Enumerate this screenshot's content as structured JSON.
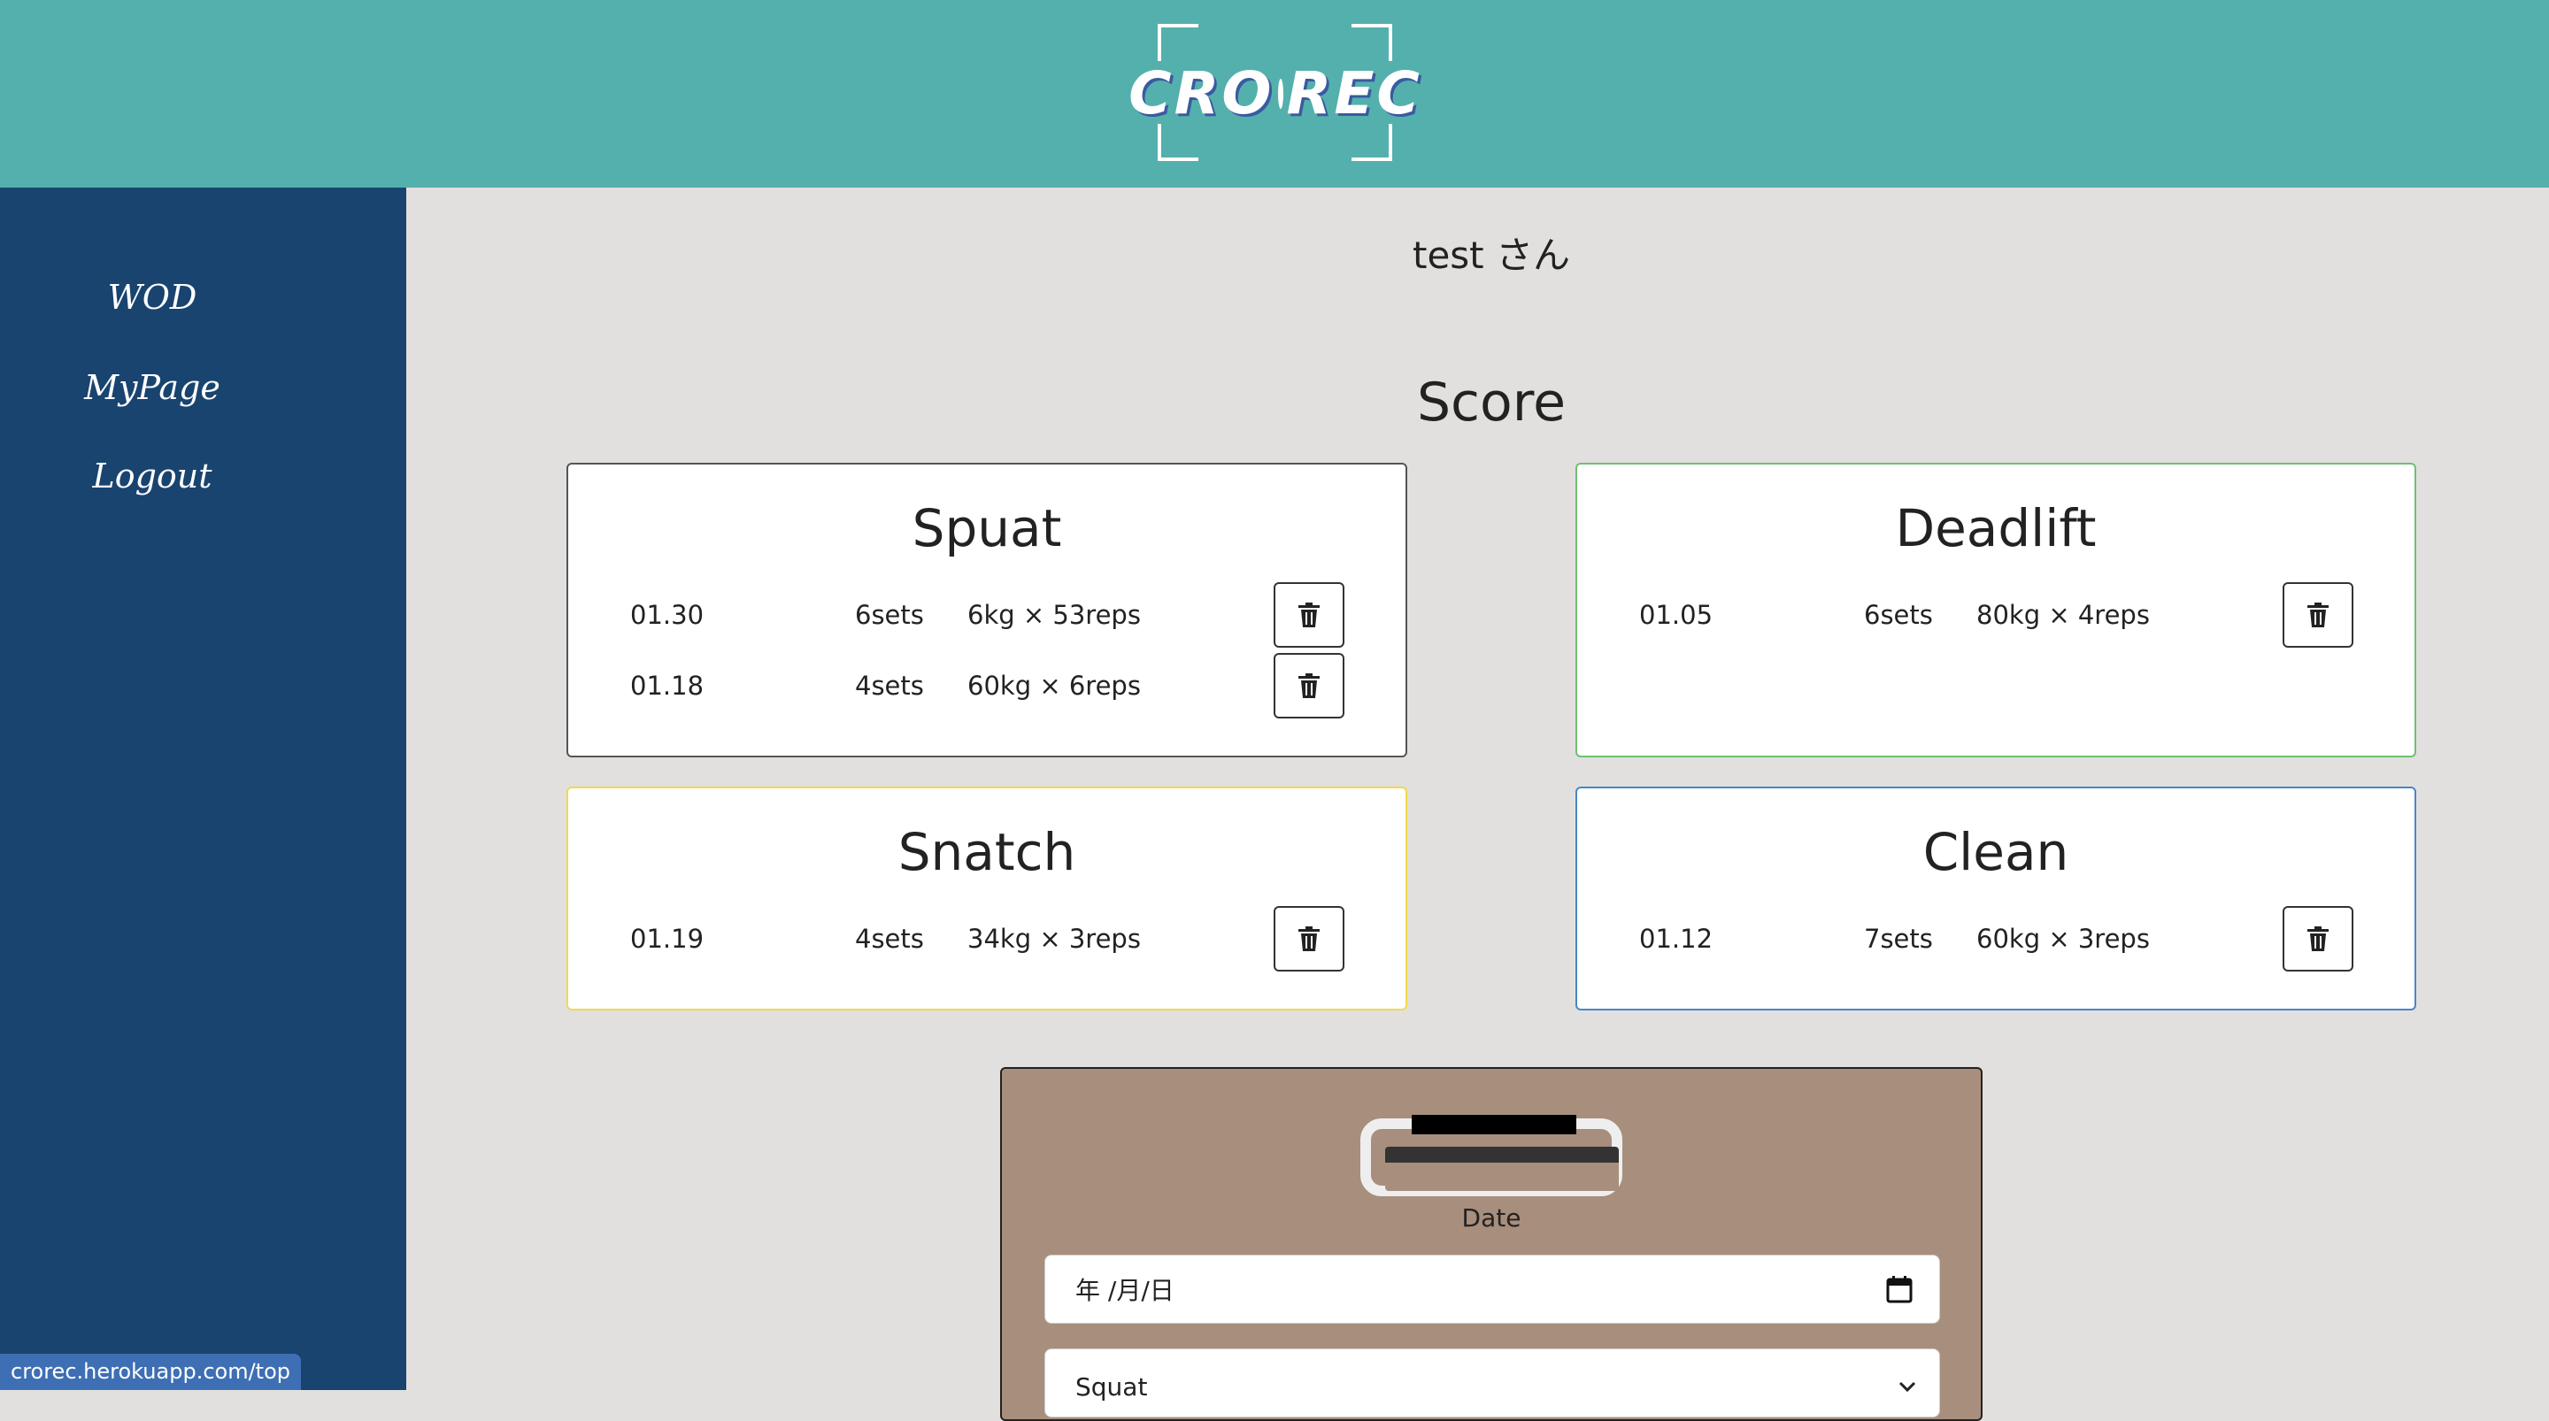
{
  "header": {
    "logo_left": "CRO",
    "logo_right": "REC",
    "colors": {
      "header_bg": "#54b0ac",
      "rec_dot": "#e0261b"
    }
  },
  "sidebar": {
    "items": [
      {
        "label": "WOD"
      },
      {
        "label": "MyPage"
      },
      {
        "label": "Logout"
      }
    ],
    "bg": "#19446f"
  },
  "main": {
    "greeting": "test さん",
    "section_title": "Score",
    "cards": [
      {
        "title": "Spuat",
        "border_color": "#555555",
        "records": [
          {
            "date": "01.30",
            "sets": "6sets",
            "detail": "6kg × 53reps"
          },
          {
            "date": "01.18",
            "sets": "4sets",
            "detail": "60kg × 6reps"
          }
        ]
      },
      {
        "title": "Deadlift",
        "border_color": "#6fbf73",
        "records": [
          {
            "date": "01.05",
            "sets": "6sets",
            "detail": "80kg × 4reps"
          }
        ]
      },
      {
        "title": "Snatch",
        "border_color": "#f2d94e",
        "records": [
          {
            "date": "01.19",
            "sets": "4sets",
            "detail": "34kg × 3reps"
          }
        ]
      },
      {
        "title": "Clean",
        "border_color": "#4a86c8",
        "records": [
          {
            "date": "01.12",
            "sets": "7sets",
            "detail": "60kg × 3reps"
          }
        ]
      }
    ],
    "delete_icon": "trash-icon"
  },
  "form": {
    "date_label": "Date",
    "date_value": "年 /月/日",
    "calendar_icon": "calendar-icon",
    "select_value": "Squat",
    "board_color": "#a88e7c"
  },
  "status_bar": {
    "url": "crorec.herokuapp.com/top"
  }
}
